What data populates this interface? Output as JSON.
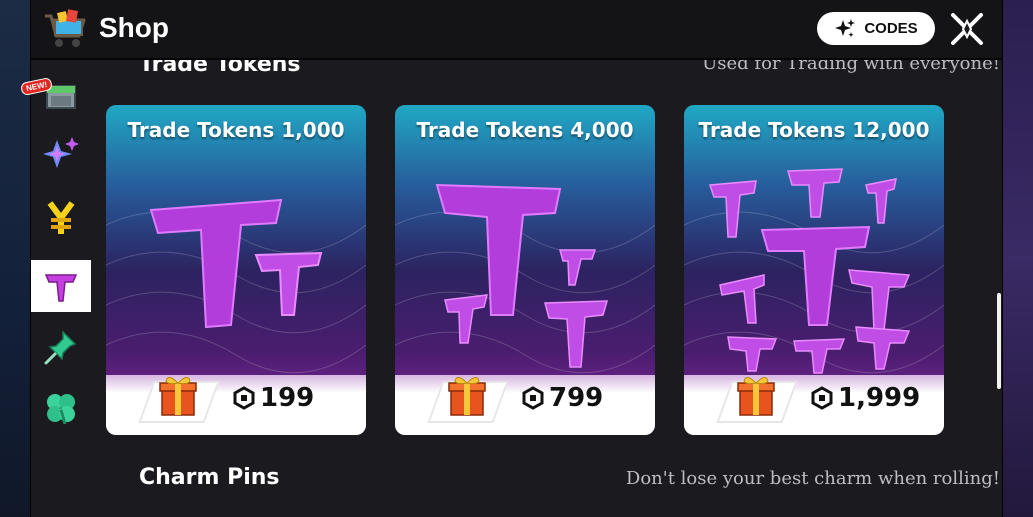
{
  "window": {
    "title": "Shop",
    "codes_label": "CODES"
  },
  "sidebar": {
    "items": [
      {
        "icon": "crate-icon",
        "badge": "NEW!"
      },
      {
        "icon": "sparkle-icon"
      },
      {
        "icon": "yen-icon"
      },
      {
        "icon": "trade-token-icon",
        "active": true
      },
      {
        "icon": "pin-icon"
      },
      {
        "icon": "clover-icon"
      }
    ]
  },
  "sections": {
    "trade_tokens": {
      "title": "Trade Tokens",
      "subtitle": "Used for Trading with everyone!"
    },
    "charm_pins": {
      "title": "Charm Pins",
      "subtitle": "Don't lose your best charm when rolling!"
    }
  },
  "cards": [
    {
      "title": "Trade Tokens 1,000",
      "price": "199"
    },
    {
      "title": "Trade Tokens 4,000",
      "price": "799"
    },
    {
      "title": "Trade Tokens 12,000",
      "price": "1,999"
    }
  ],
  "colors": {
    "accent_magenta": "#c53ee0",
    "token_purple": "#b23ddb",
    "card_top": "#20a8c4",
    "card_bottom": "#8b2aa8"
  }
}
